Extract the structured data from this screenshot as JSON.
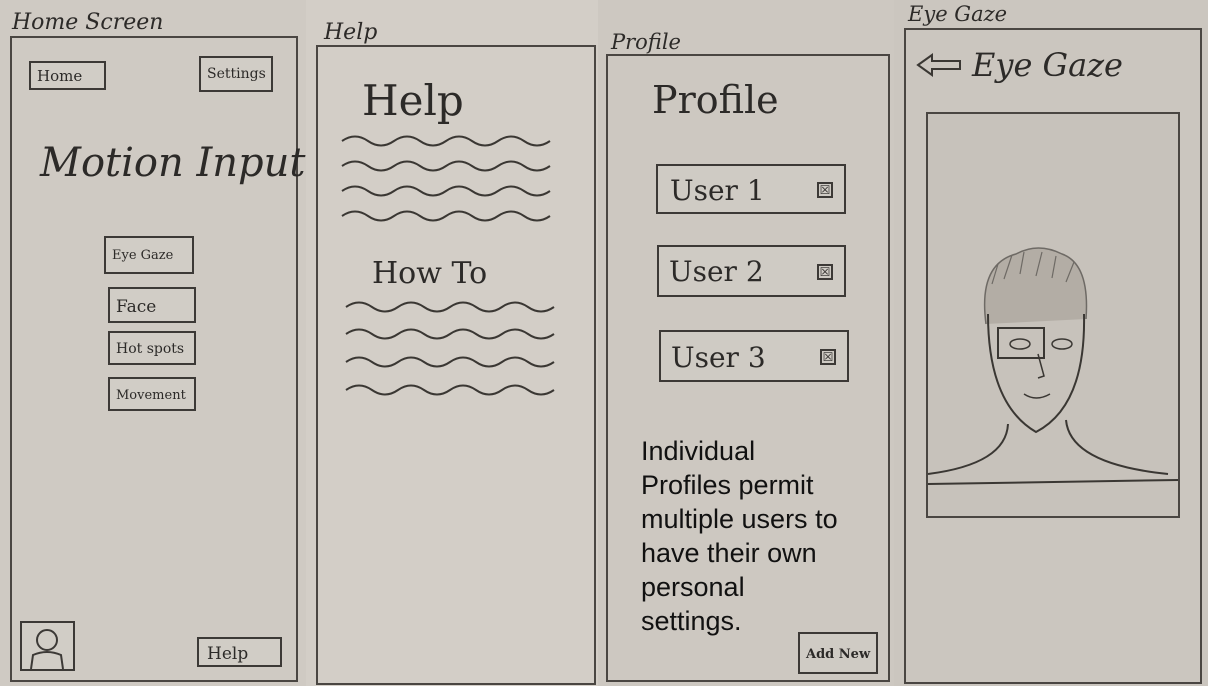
{
  "home": {
    "screen_label": "Home Screen",
    "home_button": "Home",
    "settings_button": "Settings",
    "app_title": "Motion Input",
    "menu": [
      "Eye Gaze",
      "Face",
      "Hot spots",
      "Movement"
    ],
    "help_button": "Help",
    "profile_icon": "person-icon"
  },
  "help": {
    "screen_label": "Help",
    "heading": "Help",
    "subheading": "How To"
  },
  "profile": {
    "screen_label": "Profile",
    "heading": "Profile",
    "users": [
      "User 1",
      "User 2",
      "User 3"
    ],
    "remove_icon_glyph": "☒",
    "add_new_button": "Add New",
    "overlay_text": "Individual Profiles permit multiple users to have their own personal settings."
  },
  "eyegaze": {
    "screen_label": "Eye Gaze",
    "back_icon": "arrow-left-icon",
    "heading": "Eye Gaze",
    "camera_icon": "face-sketch-icon"
  }
}
